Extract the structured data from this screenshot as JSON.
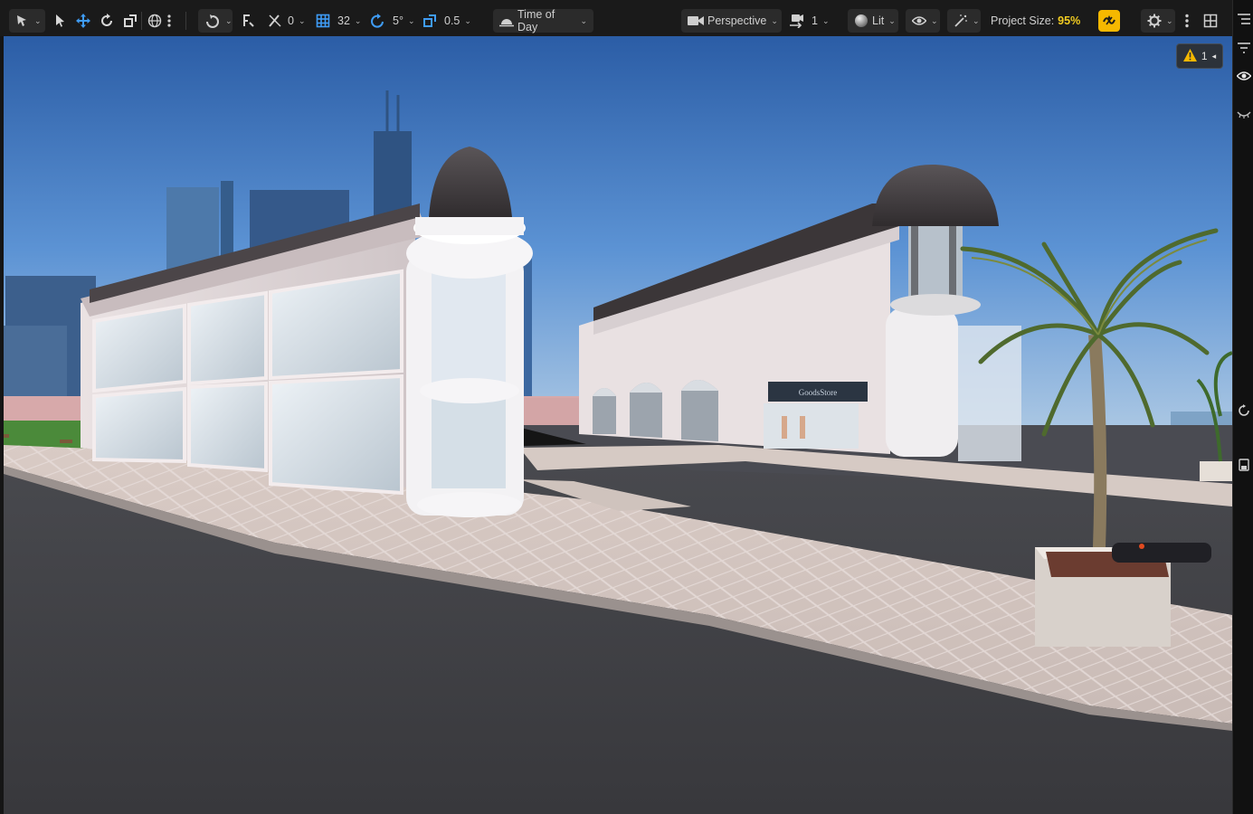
{
  "toolbar": {
    "select_mode_icon": "select-mode-icon",
    "snap_rotation_value": "0",
    "grid_snap_value": "32",
    "rotation_snap_value": "5°",
    "scale_snap_value": "0.5",
    "time_of_day_label": "Time of Day",
    "perspective_label": "Perspective",
    "camera_speed_value": "1",
    "lit_label": "Lit",
    "project_size_label": "Project Size:",
    "project_size_value": "95%"
  },
  "viewport": {
    "warning_count": "1",
    "store_sign": "GoodsStore"
  },
  "colors": {
    "toolbar_bg": "#1a1a1a",
    "accent_blue": "#3f9cf5",
    "project_size_yellow": "#f2cc21",
    "realtime_button_bg": "#f5b800"
  }
}
